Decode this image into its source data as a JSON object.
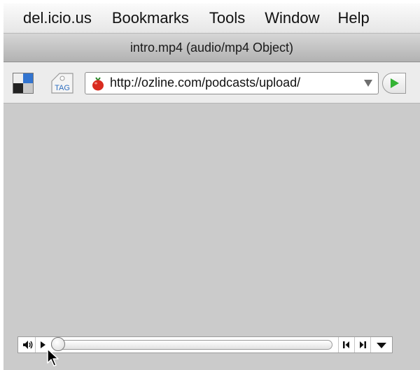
{
  "menubar": {
    "items": [
      "del.icio.us",
      "Bookmarks",
      "Tools",
      "Window",
      "Help"
    ]
  },
  "window": {
    "title": "intro.mp4 (audio/mp4 Object)"
  },
  "toolbar": {
    "delicious_icon": "delicious-logo-icon",
    "tag_icon": "tag-icon",
    "tag_label": "TAG",
    "address": {
      "url": "http://ozline.com/podcasts/upload/",
      "favicon": "tomato-icon"
    },
    "go_icon": "play-arrow-icon"
  },
  "player": {
    "controls": [
      "volume-icon",
      "play-icon",
      "step-back-icon",
      "step-forward-icon",
      "menu-icon"
    ],
    "progress": 0,
    "accent_colors": {
      "go": "#34b334",
      "delicious_blue": "#3274d0"
    }
  },
  "cursor": "arrow-pointer"
}
